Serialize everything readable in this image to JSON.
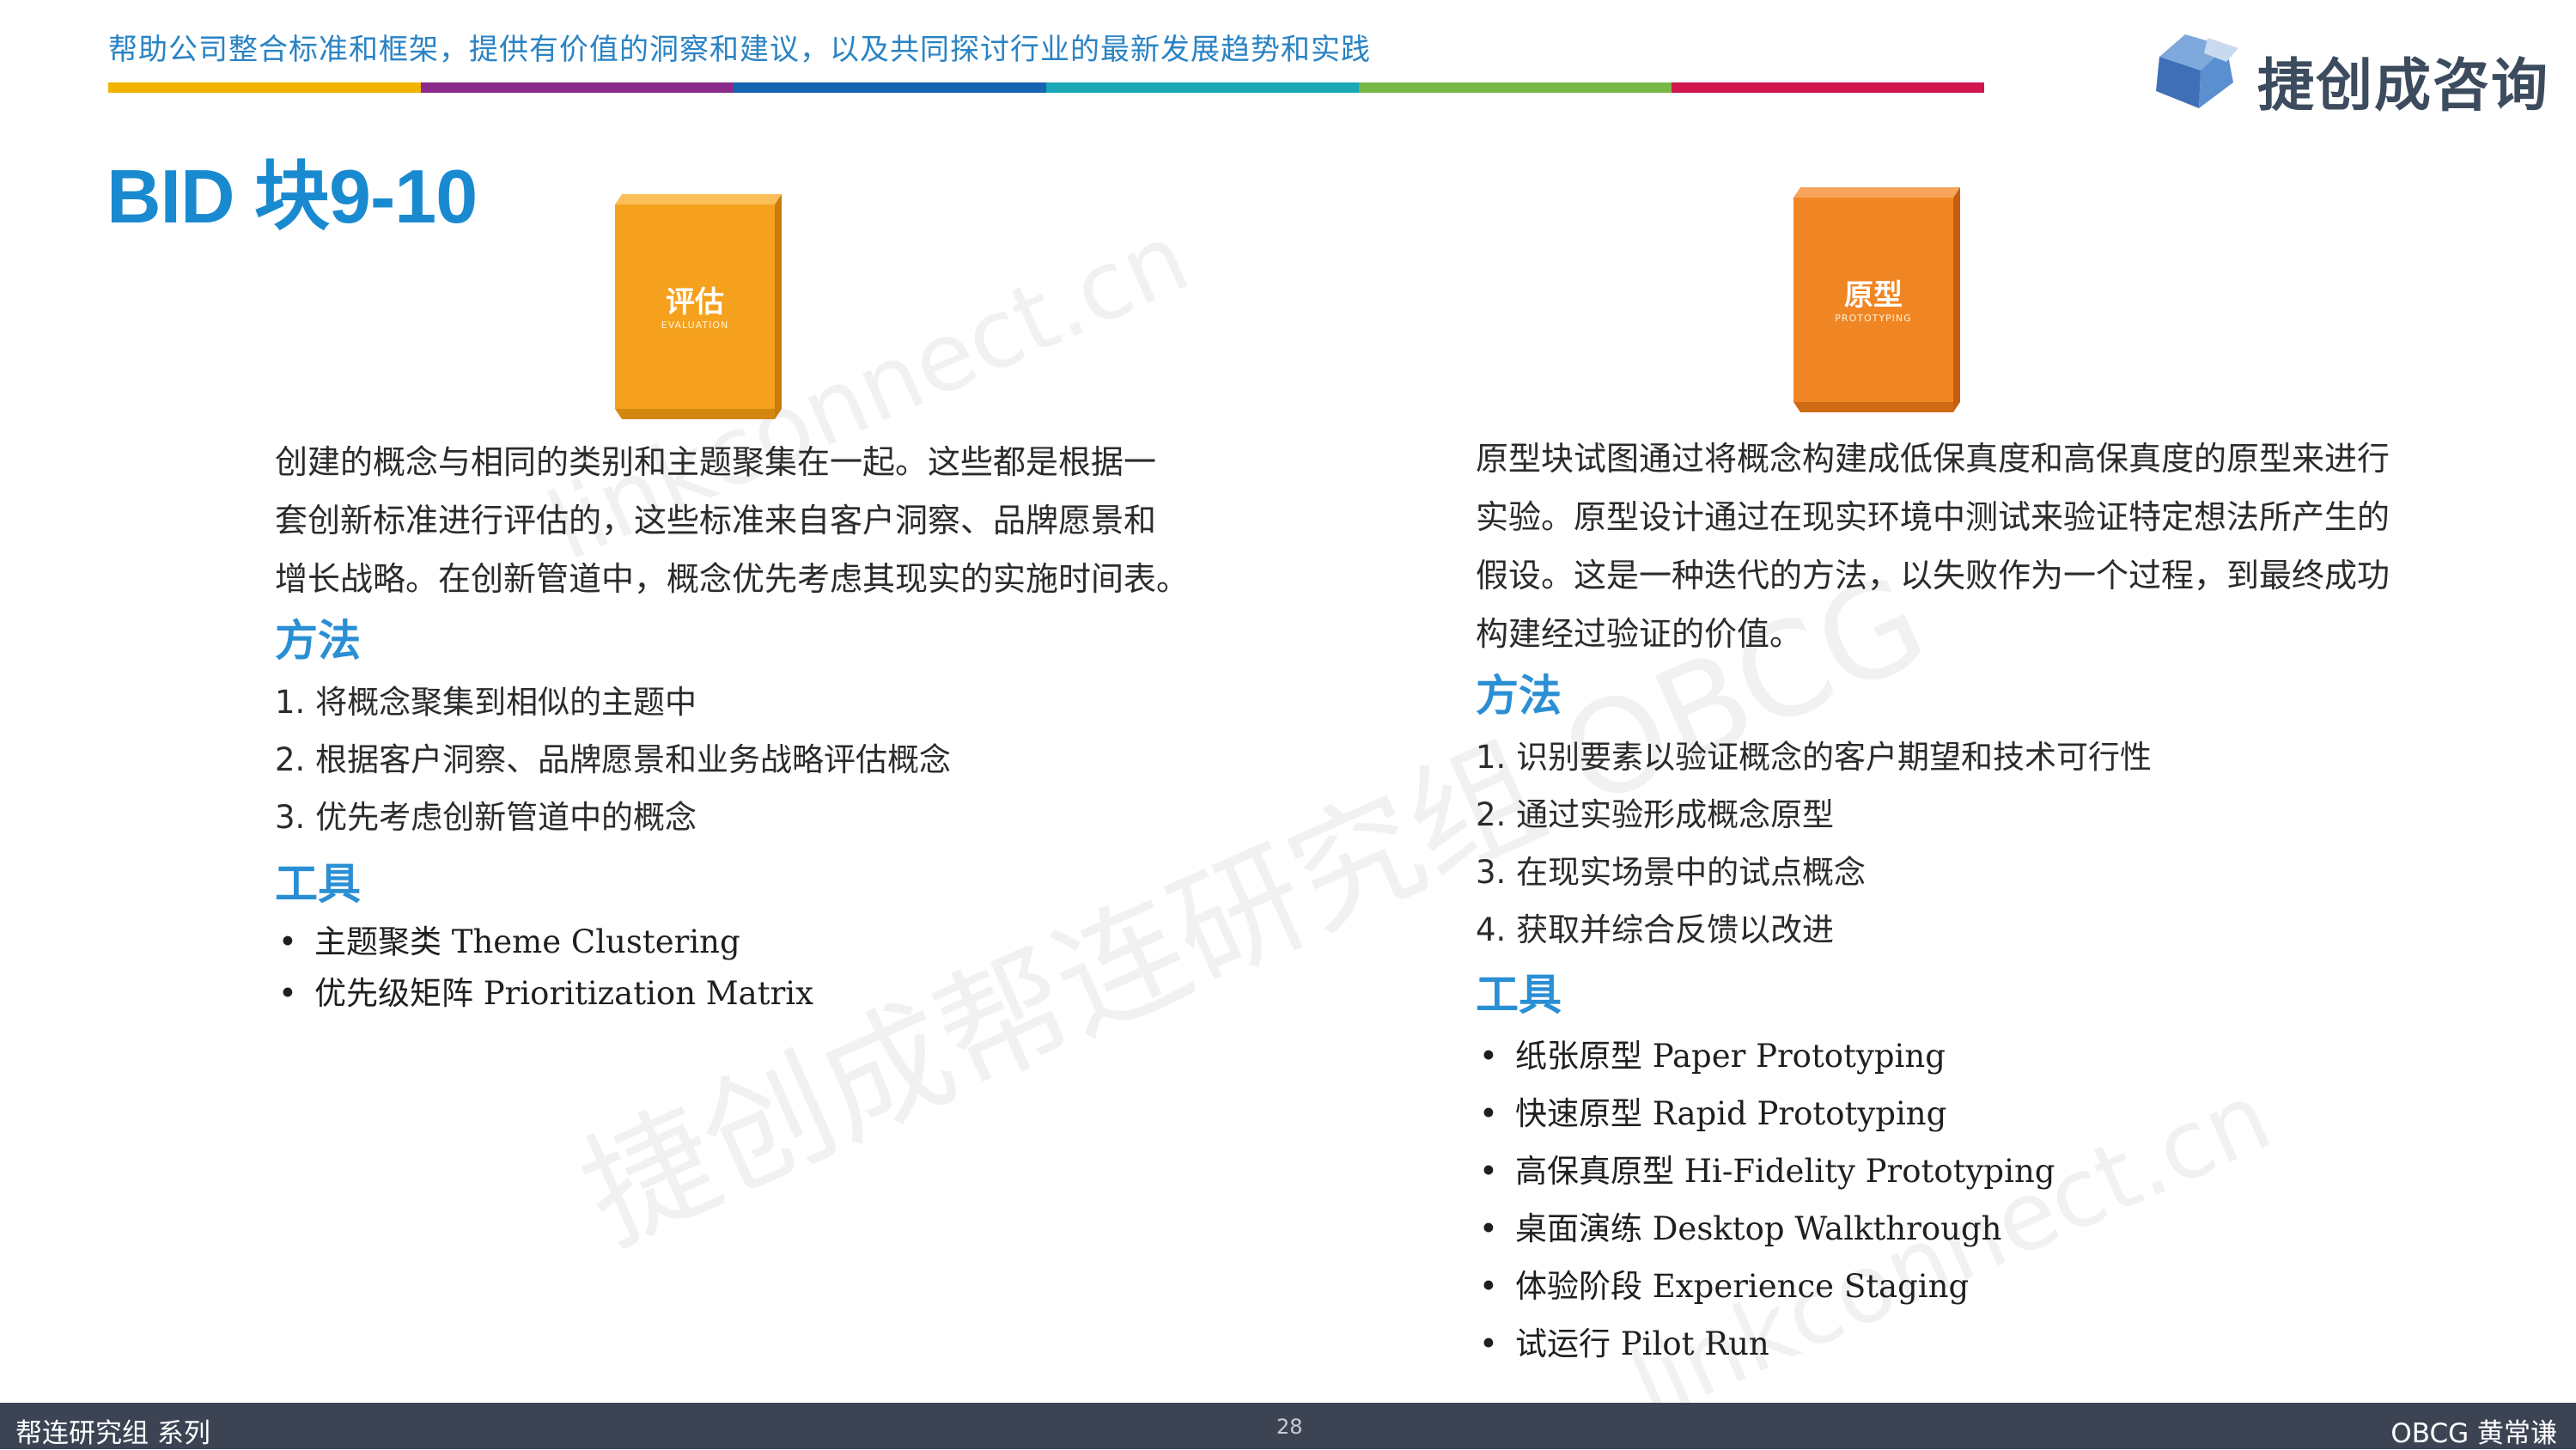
{
  "header": {
    "tagline": "帮助公司整合标准和框架，提供有价值的洞察和建议，以及共同探讨行业的最新发展趋势和实践",
    "color_bar": [
      "#f0b400",
      "#8b2a8a",
      "#1664b0",
      "#1aa7b5",
      "#76b843",
      "#d0174d"
    ],
    "logo_text": "捷创成咨询",
    "logo_icon": "cube-logo-icon"
  },
  "page_title": "BID 块9-10",
  "colors": {
    "accent_blue": "#2a8fd4",
    "book_orange_left": "#f6a11d",
    "book_orange_right": "#f08524",
    "footer_bg": "#3c4454"
  },
  "left": {
    "book_label": "评估",
    "book_sublabel": "EVALUATION",
    "description": [
      "创建的概念与相同的类别和主题聚集在一起。这些都是根据一",
      "套创新标准进行评估的，这些标准来自客户洞察、品牌愿景和",
      "增长战略。在创新管道中，概念优先考虑其现实的实施时间表。"
    ],
    "method_title": "方法",
    "methods": [
      "1. 将概念聚集到相似的主题中",
      "2. 根据客户洞察、品牌愿景和业务战略评估概念",
      "3. 优先考虑创新管道中的概念"
    ],
    "tools_title": "工具",
    "tools": [
      "主题聚类 Theme Clustering",
      "优先级矩阵 Prioritization Matrix"
    ]
  },
  "right": {
    "book_label": "原型",
    "book_sublabel": "PROTOTYPING",
    "description": [
      "原型块试图通过将概念构建成低保真度和高保真度的原型来进行",
      "实验。原型设计通过在现实环境中测试来验证特定想法所产生的",
      "假设。这是一种迭代的方法，以失败作为一个过程，到最终成功",
      "构建经过验证的价值。"
    ],
    "method_title": "方法",
    "methods": [
      "1. 识别要素以验证概念的客户期望和技术可行性",
      "2. 通过实验形成概念原型",
      "3. 在现实场景中的试点概念",
      "4. 获取并综合反馈以改进"
    ],
    "tools_title": "工具",
    "tools": [
      "纸张原型 Paper Prototyping",
      "快速原型 Rapid Prototyping",
      "高保真原型 Hi-Fidelity Prototyping",
      "桌面演练 Desktop Walkthrough",
      "体验阶段 Experience Staging",
      "试运行 Pilot Run"
    ]
  },
  "watermarks": {
    "main": "捷创成帮连研究组 OBCG",
    "url": "linkconnect.cn"
  },
  "footer": {
    "left": "帮连研究组 系列",
    "page": "28",
    "right": "OBCG 黄常谦"
  }
}
